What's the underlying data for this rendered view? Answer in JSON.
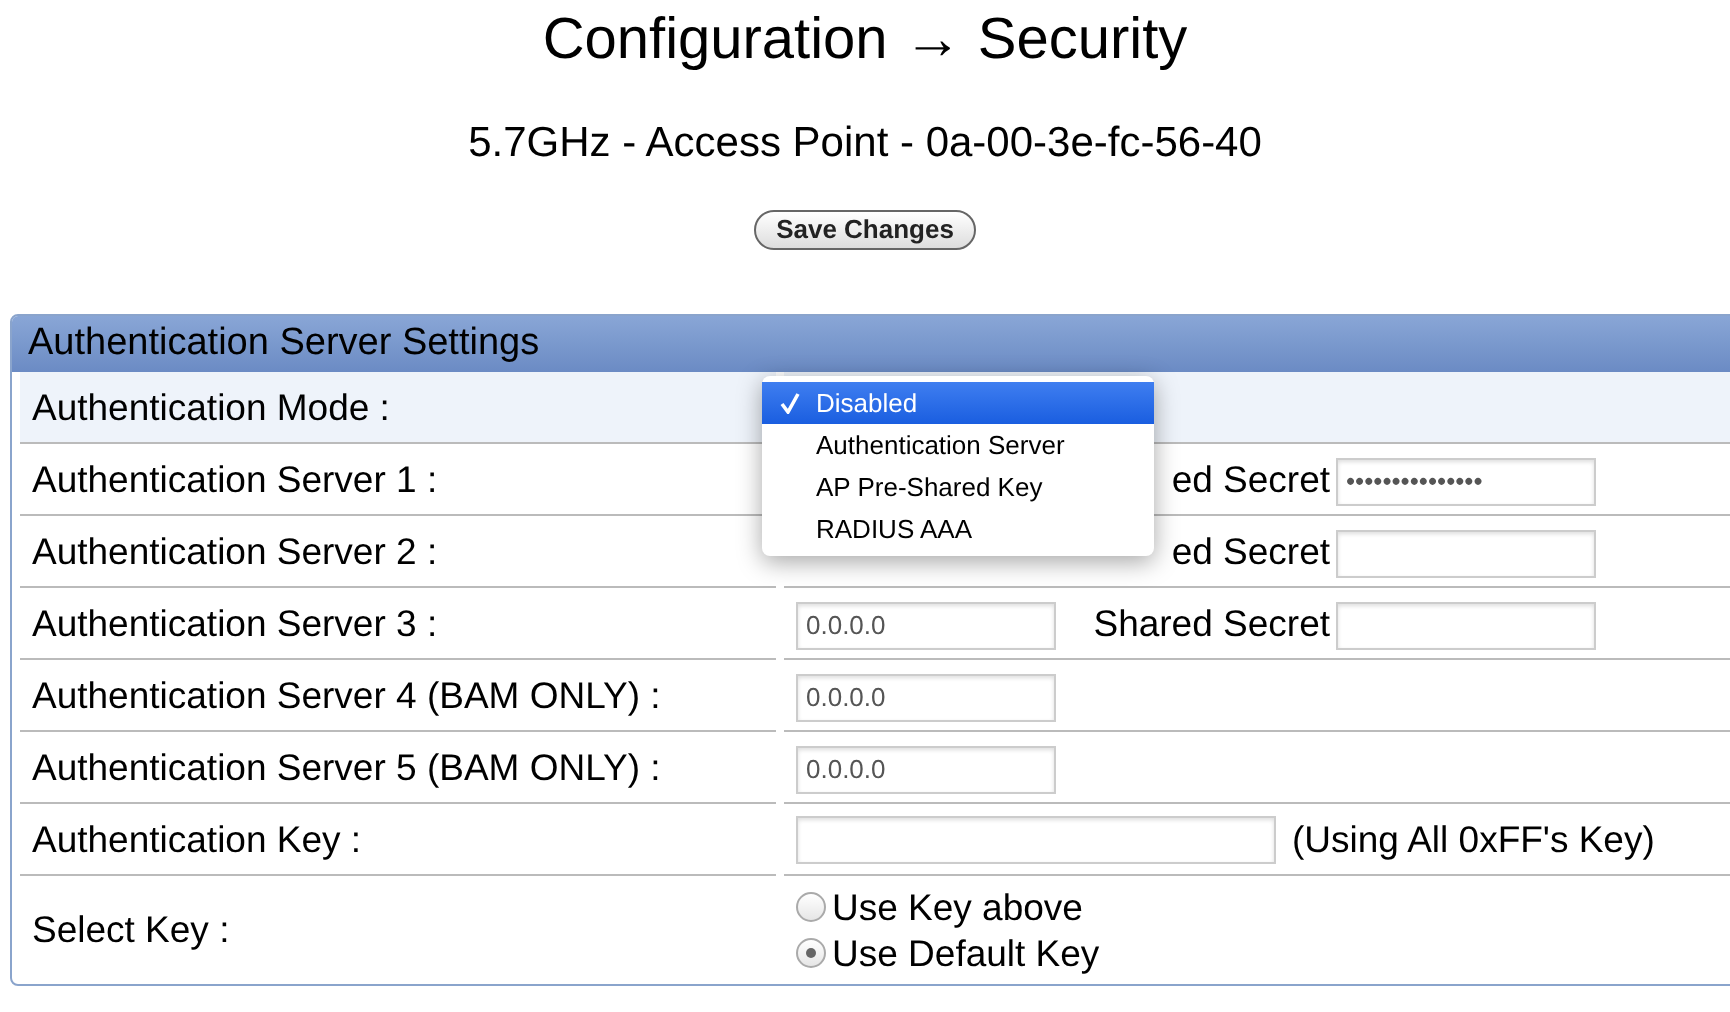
{
  "title": "Configuration → Security",
  "subtitle": "5.7GHz - Access Point - 0a-00-3e-fc-56-40",
  "save_button": "Save Changes",
  "panel": {
    "title": "Authentication Server Settings",
    "rows": [
      {
        "kind": "mode",
        "label": "Authentication Mode :"
      },
      {
        "kind": "server",
        "label": "Authentication Server 1 :",
        "secret_label": "ed Secret",
        "secret_value": "•••••••••••••••"
      },
      {
        "kind": "server",
        "label": "Authentication Server 2 :",
        "secret_label": "ed Secret"
      },
      {
        "kind": "server",
        "label": "Authentication Server 3 :",
        "address": "0.0.0.0",
        "secret_label": "Shared Secret"
      },
      {
        "kind": "address",
        "label": "Authentication Server 4 (BAM ONLY) :",
        "address": "0.0.0.0"
      },
      {
        "kind": "address",
        "label": "Authentication Server 5 (BAM ONLY) :",
        "address": "0.0.0.0"
      },
      {
        "kind": "key",
        "label": "Authentication Key :",
        "note": "(Using All 0xFF's Key)"
      },
      {
        "kind": "radios",
        "label": "Select Key :",
        "options": [
          {
            "label": "Use Key above",
            "selected": false
          },
          {
            "label": "Use Default Key",
            "selected": true
          }
        ]
      }
    ]
  },
  "dropdown": {
    "options": [
      {
        "label": "Disabled",
        "selected": true
      },
      {
        "label": "Authentication Server",
        "selected": false
      },
      {
        "label": "AP Pre-Shared Key",
        "selected": false
      },
      {
        "label": "RADIUS AAA",
        "selected": false
      }
    ]
  }
}
